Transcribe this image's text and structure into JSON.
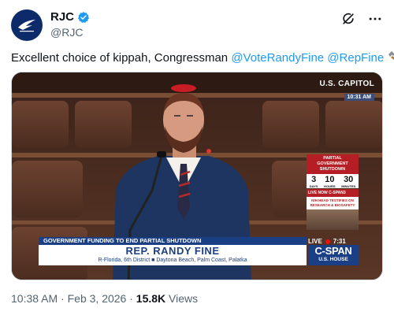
{
  "author": {
    "name": "RJC",
    "handle": "@RJC",
    "avatar_icon": "rjc-logo-icon",
    "verified_icon": "verified-badge-icon"
  },
  "header_icons": [
    "grok-icon",
    "more-icon"
  ],
  "tweet": {
    "text_prefix": "Excellent choice of kippah, Congressman ",
    "mention1": "@VoteRandyFine",
    "mention2": "@RepFine",
    "emoji_icon": "hammer-emoji-icon"
  },
  "video": {
    "location_label": "U.S. CAPITOL",
    "time_label": "10:31 AM",
    "shutdown": {
      "title_line1": "PARTIAL GOVERNMENT",
      "title_line2": "SHUTDOWN",
      "days": "3",
      "hours": "10",
      "minutes": "30",
      "days_label": "DAYS",
      "hours_label": "HOURS",
      "minutes_label": "MINUTES",
      "live_now": "LIVE NOW C-SPAN3",
      "sub_line1": "NIH HEAD TESTIFIES ON",
      "sub_line2": "RESEARCH & BIOSAFETY"
    },
    "live_label": "LIVE",
    "live_time": "7:31",
    "banner": "GOVERNMENT FUNDING TO END PARTIAL SHUTDOWN",
    "speaker_name": "REP. RANDY FINE",
    "speaker_party": "R-Florida, 6th District",
    "speaker_places": "Daytona Beach, Palm Coast, Palatka",
    "network_name": "C-SPAN",
    "network_sub": "U.S. HOUSE"
  },
  "meta": {
    "time": "10:38 AM",
    "date": "Feb 3, 2026",
    "views_count": "15.8K",
    "views_label": "Views"
  },
  "colors": {
    "link": "#1d9bf0",
    "cspan_blue": "#1b3f84",
    "alert_red": "#b51e24"
  }
}
